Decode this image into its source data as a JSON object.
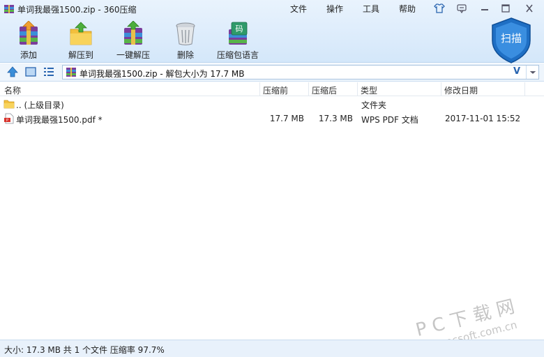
{
  "window": {
    "title": "单词我最强1500.zip - 360压缩",
    "menu": [
      "文件",
      "操作",
      "工具",
      "帮助"
    ]
  },
  "toolbar": {
    "items": [
      {
        "label": "添加",
        "icon": "add-archive-icon"
      },
      {
        "label": "解压到",
        "icon": "extract-to-icon"
      },
      {
        "label": "一键解压",
        "icon": "one-click-extract-icon"
      },
      {
        "label": "删除",
        "icon": "trash-icon"
      },
      {
        "label": "压缩包语言",
        "icon": "archive-language-icon"
      }
    ],
    "scan_label": "扫描",
    "scan_label_icon": "shield-icon"
  },
  "address": {
    "path": "单词我最强1500.zip - 解包大小为 17.7 MB",
    "v_label": "V"
  },
  "table": {
    "columns": [
      "名称",
      "压缩前",
      "压缩后",
      "类型",
      "修改日期"
    ],
    "rows": [
      {
        "name": ".. (上级目录)",
        "before": "",
        "after": "",
        "type": "文件夹",
        "date": "",
        "icon": "folder-icon"
      },
      {
        "name": "单词我最强1500.pdf *",
        "before": "17.7 MB",
        "after": "17.3 MB",
        "type": "WPS PDF 文档",
        "date": "2017-11-01 15:52",
        "icon": "pdf-file-icon"
      }
    ]
  },
  "status": {
    "text": "大小: 17.3 MB 共 1 个文件 压缩率 97.7%"
  },
  "watermark": {
    "line1": "P C 下 载 网",
    "line2": "www.pcsoft.com.cn"
  },
  "colors": {
    "toolbar_bg": "#d4e7fa",
    "accent": "#2a65b0",
    "shield": "#1f6fc4"
  }
}
